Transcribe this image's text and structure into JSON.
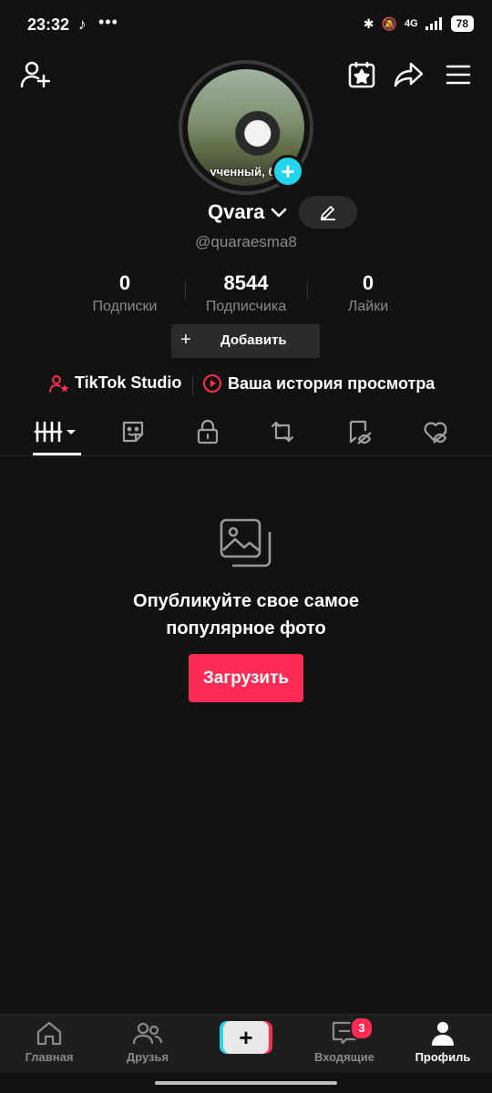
{
  "status_bar": {
    "time": "23:32",
    "dots": "•••",
    "net": "4G",
    "battery": "78"
  },
  "profile": {
    "avatar_caption": "ученный, ба",
    "display_name": "Qvara",
    "handle": "@quaraesma8"
  },
  "stats": [
    {
      "value": "0",
      "label": "Подписки"
    },
    {
      "value": "8544",
      "label": "Подписчика"
    },
    {
      "value": "0",
      "label": "Лайки"
    }
  ],
  "add_button": {
    "plus": "+",
    "label": "Добавить"
  },
  "links": {
    "studio": "TikTok Studio",
    "history": "Ваша история просмотра"
  },
  "empty_state": {
    "title_line1": "Опубликуйте свое самое",
    "title_line2": "популярное фото",
    "upload": "Загрузить"
  },
  "nav": {
    "home": "Главная",
    "friends": "Друзья",
    "inbox": "Входящие",
    "inbox_badge": "3",
    "profile": "Профиль"
  },
  "colors": {
    "accent": "#fe2c55",
    "cyan": "#20d5ec",
    "background": "#121212"
  }
}
